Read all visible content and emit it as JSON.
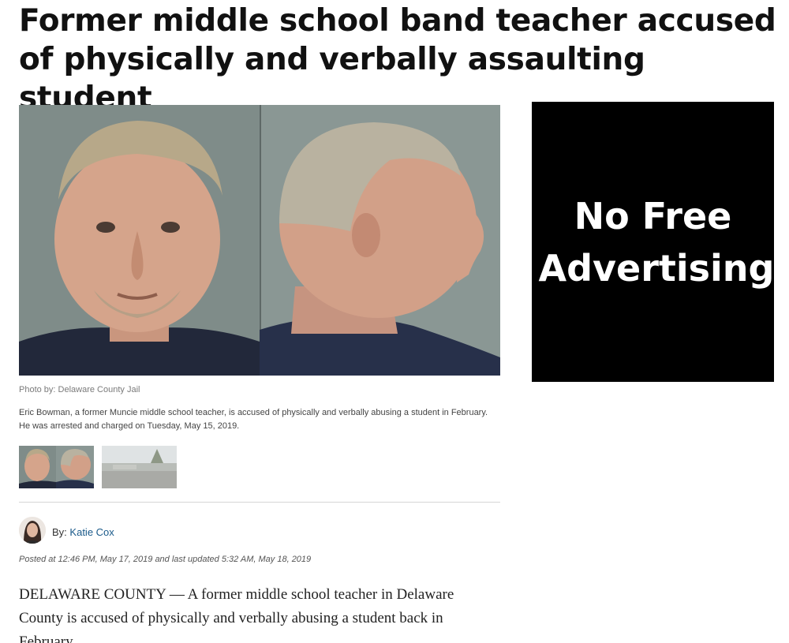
{
  "article": {
    "headline": "Former middle school band teacher accused of physically and verbally assaulting student",
    "photo_credit": "Photo by: Delaware County Jail",
    "caption": "Eric Bowman, a former Muncie middle school teacher, is accused of physically and verbally abusing a student in February. He was arrested and charged on Tuesday, May 15, 2019.",
    "byline_prefix": "By:",
    "author": "Katie Cox",
    "posted": "Posted at 12:46 PM, May 17, 2019 and last updated 5:32 AM, May 18, 2019",
    "body_lead": "DELAWARE COUNTY — A former middle school teacher in Delaware County is accused of physically and verbally abusing a student back in February."
  },
  "gallery": {
    "thumbnails": [
      {
        "label": "mugshot-thumbnail",
        "selected": true
      },
      {
        "label": "school-exterior-thumbnail",
        "selected": false
      }
    ]
  },
  "ad": {
    "text": "No Free Advertising",
    "background": "#000000",
    "color": "#ffffff"
  },
  "colors": {
    "author_link": "#1a5a8a",
    "divider": "#d6d6d6"
  }
}
